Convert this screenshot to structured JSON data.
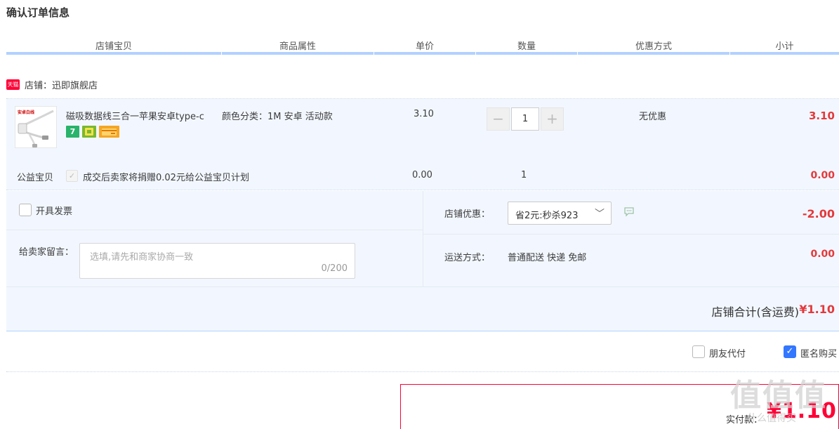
{
  "page": {
    "title": "确认订单信息"
  },
  "table_headers": [
    "店铺宝贝",
    "商品属性",
    "单价",
    "数量",
    "优惠方式",
    "小计"
  ],
  "shop": {
    "badge": "天猫",
    "label": "店铺：迅即旗舰店"
  },
  "item": {
    "thumb_text": "安卓白线",
    "title": "磁吸数据线三合一苹果安卓type-c",
    "badges": [
      "7",
      "",
      ""
    ],
    "attributes": "颜色分类：1M 安卓 活动款",
    "unit_price": "3.10",
    "quantity": "1",
    "qty_minus": "−",
    "qty_plus": "+",
    "discount": "无优惠",
    "subtotal": "3.10"
  },
  "charity": {
    "label": "公益宝贝",
    "check_glyph": "✓",
    "text": "成交后卖家将捐赠0.02元给公益宝贝计划",
    "price": "0.00",
    "quantity": "1",
    "subtotal": "0.00"
  },
  "invoice": {
    "label": "开具发票",
    "checked": false
  },
  "message": {
    "label": "给卖家留言：",
    "placeholder": "选填,请先和商家协商一致",
    "counter": "0/200"
  },
  "store_discount": {
    "label": "店铺优惠：",
    "selected": "省2元:秒杀923",
    "caret": "﹀",
    "amount": "-2.00"
  },
  "shipping": {
    "label": "运送方式：",
    "value": "普通配送 快递 免邮",
    "amount": "0.00"
  },
  "shop_total": {
    "label": "店铺合计(含运费)",
    "amount": "¥1.10"
  },
  "options": {
    "friend_pay": {
      "label": "朋友代付",
      "checked": false
    },
    "anonymous": {
      "label": "匿名购买",
      "checked": true,
      "check_glyph": "✓"
    }
  },
  "payment": {
    "label": "实付款：",
    "amount": "¥1.10"
  },
  "watermark": {
    "big": "值值值",
    "small": "什么值得买"
  },
  "colors": {
    "accent_red": "#e4393c",
    "tmall_red": "#ff0036",
    "header_bar": "#b2d1ff",
    "row_bg": "#f2f7ff",
    "checkbox_blue": "#3377ff"
  }
}
